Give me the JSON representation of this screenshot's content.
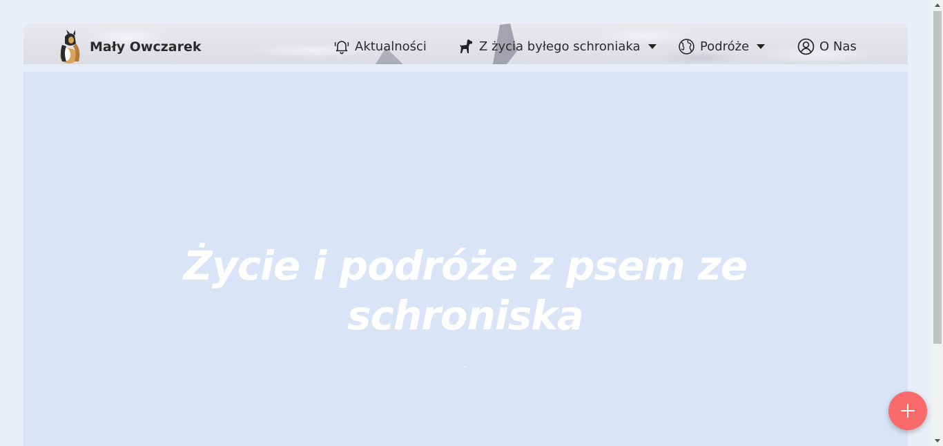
{
  "brand": {
    "name": "Mały Owczarek",
    "logo_icon": "sheepdog-logo-icon"
  },
  "nav": {
    "items": [
      {
        "label": "Aktualności",
        "icon": "bell-icon",
        "dropdown": false
      },
      {
        "label": "Z życia byłego schroniaka",
        "icon": "dog-icon",
        "dropdown": true
      },
      {
        "label": "Podróże",
        "icon": "globe-icon",
        "dropdown": true
      },
      {
        "label": "O Nas",
        "icon": "user-circle-icon",
        "dropdown": false
      }
    ]
  },
  "hero": {
    "title_line1": "Życie i podróże z psem ze",
    "title_line2": "schroniska"
  },
  "fab": {
    "icon": "plus-icon",
    "color": "#f96a6a"
  },
  "colors": {
    "hero_bg": "#d9e4f7",
    "page_bg": "#e9eef8"
  }
}
